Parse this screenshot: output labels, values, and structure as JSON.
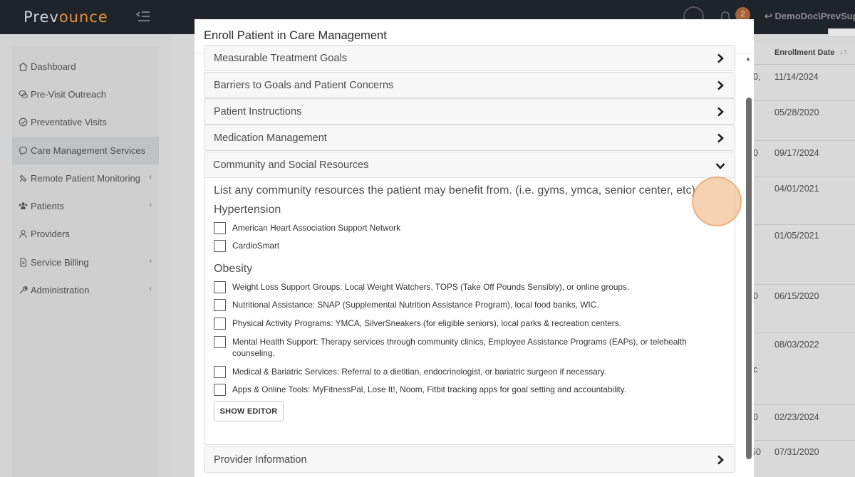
{
  "app": {
    "brand_part1": "Prev",
    "brand_part2": "ounce",
    "notification_count": "2",
    "user": "DemoDoc\\PrevSup"
  },
  "sidebar": {
    "items": [
      {
        "label": "Dashboard",
        "icon": "home-icon"
      },
      {
        "label": "Pre-Visit Outreach",
        "icon": "chat-icon"
      },
      {
        "label": "Preventative Visits",
        "icon": "check-circle-icon"
      },
      {
        "label": "Care Management Services",
        "icon": "chat-bubble-icon",
        "active": true
      },
      {
        "label": "Remote Patient Monitoring",
        "icon": "satellite-icon",
        "chevron": "‹"
      },
      {
        "label": "Patients",
        "icon": "users-icon",
        "chevron": "‹"
      },
      {
        "label": "Providers",
        "icon": "user-icon"
      },
      {
        "label": "Service Billing",
        "icon": "file-icon",
        "chevron": "‹"
      },
      {
        "label": "Administration",
        "icon": "wrench-icon",
        "chevron": "‹"
      }
    ]
  },
  "table": {
    "header": "Enrollment Date",
    "dates": [
      "11/14/2024",
      "05/28/2020",
      "09/17/2024",
      "04/01/2021",
      "01/05/2021",
      "06/15/2020",
      "08/03/2022",
      "02/23/2024",
      "07/31/2020"
    ],
    "cut_fragments": [
      "0,",
      "0",
      "0",
      "c",
      "0",
      "50"
    ]
  },
  "modal": {
    "title": "Enroll Patient in Care Management",
    "sections_before": [
      "Measurable Treatment Goals",
      "Barriers to Goals and Patient Concerns",
      "Patient Instructions",
      "Medication Management"
    ],
    "open_section": {
      "title": "Community and Social Resources",
      "intro": "List any community resources the patient may benefit from. (i.e. gyms, ymca, senior center, etc)",
      "groups": [
        {
          "name": "Hypertension",
          "options": [
            "American Heart Association Support Network",
            "CardioSmart"
          ]
        },
        {
          "name": "Obesity",
          "options": [
            "Weight Loss Support Groups: Local Weight Watchers, TOPS (Take Off Pounds Sensibly), or online groups.",
            "Nutritional Assistance: SNAP (Supplemental Nutrition Assistance Program), local food banks, WIC.",
            "Physical Activity Programs: YMCA, SilverSneakers (for eligible seniors), local parks & recreation centers.",
            "Mental Health Support: Therapy services through community clinics, Employee Assistance Programs (EAPs), or telehealth counseling.",
            "Medical & Bariatric Services: Referral to a dietitian, endocrinologist, or bariatric surgeon if necessary.",
            "Apps & Online Tools: MyFitnessPal, Lose It!, Noom, Fitbit tracking apps for goal setting and accountability."
          ]
        }
      ],
      "editor_button": "SHOW EDITOR"
    },
    "sections_after": [
      "Provider Information"
    ]
  }
}
